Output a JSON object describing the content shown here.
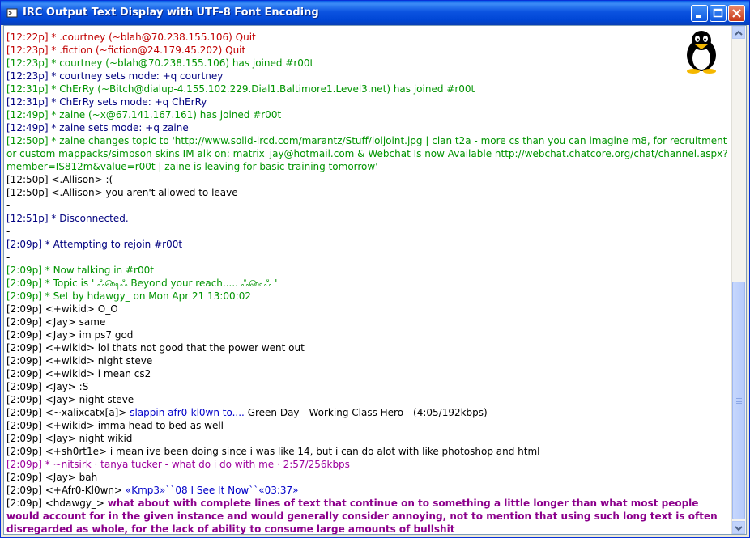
{
  "window": {
    "title": "IRC Output Text Display with UTF-8 Font Encoding",
    "buttons": [
      "minimize",
      "maximize",
      "close"
    ]
  },
  "icons": {
    "app": "irc-app-icon",
    "mascot": "penguin-icon"
  },
  "colors": {
    "quit": "#c00000",
    "join_mode": "#009300",
    "mode": "#00007f",
    "highlight": "#8b008b"
  },
  "log": [
    {
      "ts": "[12:22p]",
      "text": " * .courtney (~blah@70.238.155.106) Quit",
      "cls": "red"
    },
    {
      "ts": "[12:23p]",
      "text": " * .fiction (~fiction@24.179.45.202) Quit",
      "cls": "red"
    },
    {
      "ts": "[12:23p]",
      "text": " * courtney (~blah@70.238.155.106) has joined #r00t",
      "cls": "grn"
    },
    {
      "ts": "[12:23p]",
      "text": " * courtney sets mode: +q courtney",
      "cls": "nav"
    },
    {
      "ts": "[12:31p]",
      "text": " * ChErRy (~Bitch@dialup-4.155.102.229.Dial1.Baltimore1.Level3.net) has joined #r00t",
      "cls": "grn"
    },
    {
      "ts": "[12:31p]",
      "text": " * ChErRy sets mode: +q ChErRy",
      "cls": "nav"
    },
    {
      "ts": "[12:49p]",
      "text": " * zaine (~x@67.141.167.161) has joined #r00t",
      "cls": "grn"
    },
    {
      "ts": "[12:49p]",
      "text": " * zaine sets mode: +q zaine",
      "cls": "nav"
    },
    {
      "ts": "[12:50p]",
      "text": " * zaine changes topic to 'http://www.solid-ircd.com/marantz/Stuff/loljoint.jpg | clan t2a - more cs than you can imagine m8, for recruitment or custom mappacks/simpson skins IM alk on: matrix_jay@hotmail.com & Webchat Is now Available  http://webchat.chatcore.org/chat/channel.aspx?member=IS812m&value=r00t | zaine is leaving for basic training tomorrow'",
      "cls": "grn",
      "wrap": true
    },
    {
      "ts": "[12:50p]",
      "text": " <.Allison> :(",
      "cls": ""
    },
    {
      "ts": "[12:50p]",
      "text": " <.Allison> you aren't allowed to leave",
      "cls": ""
    },
    {
      "ts": "",
      "text": "-",
      "cls": ""
    },
    {
      "ts": "[12:51p]",
      "text": " * Disconnected.",
      "cls": "nav"
    },
    {
      "ts": "",
      "text": "-",
      "cls": ""
    },
    {
      "ts": "[2:09p]",
      "text": " * Attempting to rejoin #r00t",
      "cls": "nav"
    },
    {
      "ts": "",
      "text": "-",
      "cls": ""
    },
    {
      "ts": "[2:09p]",
      "text": " * Now talking in #r00t",
      "cls": "grn"
    },
    {
      "ts": "[2:09p]",
      "text": " * Topic is ' ஃ௸ஃ Beyond your reach..... ஃ௸ஃ '",
      "cls": "grn"
    },
    {
      "ts": "[2:09p]",
      "text": " * Set by hdawgy_ on Mon Apr 21 13:00:02",
      "cls": "grn"
    },
    {
      "ts": "[2:09p]",
      "text": " <+wikid> O_O",
      "cls": ""
    },
    {
      "ts": "[2:09p]",
      "text": " <Jay> same",
      "cls": ""
    },
    {
      "ts": "[2:09p]",
      "text": " <Jay> im ps7 god",
      "cls": ""
    },
    {
      "ts": "[2:09p]",
      "text": " <+wikid> lol thats not good that the power went out",
      "cls": ""
    },
    {
      "ts": "[2:09p]",
      "text": " <+wikid> night steve",
      "cls": ""
    },
    {
      "ts": "[2:09p]",
      "text": " <+wikid> i mean cs2",
      "cls": ""
    },
    {
      "ts": "[2:09p]",
      "text": " <Jay> :S",
      "cls": ""
    },
    {
      "ts": "[2:09p]",
      "text": " <Jay> night steve",
      "cls": ""
    },
    {
      "ts": "[2:09p]",
      "text": " <~xalixcatx[a]> ",
      "cls": "",
      "extra": "slappin afr0-kl0wn to.... ",
      "extra2": "Green Day - Working Class Hero - (4:05/192kbps)"
    },
    {
      "ts": "[2:09p]",
      "text": " <+wikid> imma head to bed as well",
      "cls": ""
    },
    {
      "ts": "[2:09p]",
      "text": " <Jay> night wikid",
      "cls": ""
    },
    {
      "ts": "[2:09p]",
      "text": " <+sh0rt1e> i mean ive been doing since i was like 14, but i can do alot with like photoshop and html",
      "cls": ""
    },
    {
      "ts": "[2:09p]",
      "text": " * ~nitsirk · tanya tucker - what do i do with me · 2:57/256kbps",
      "cls": "pur"
    },
    {
      "ts": "[2:09p]",
      "text": " <Jay> bah",
      "cls": ""
    },
    {
      "ts": "[2:09p]",
      "text": " <+Afr0-Kl0wn> ",
      "cls": "",
      "extra": "«Kmp3»``08 I See It Now``«03:37»"
    },
    {
      "ts": "[2:09p]",
      "text": " <hdawgy_> ",
      "cls": "",
      "rainbow": "what about with complete lines of text that continue on to something a little longer than what most people would account for in the given instance and would generally consider annoying, not to mention that using such long text is often disregarded as whole, for the lack of ability to consume large amounts of bullshit"
    }
  ]
}
